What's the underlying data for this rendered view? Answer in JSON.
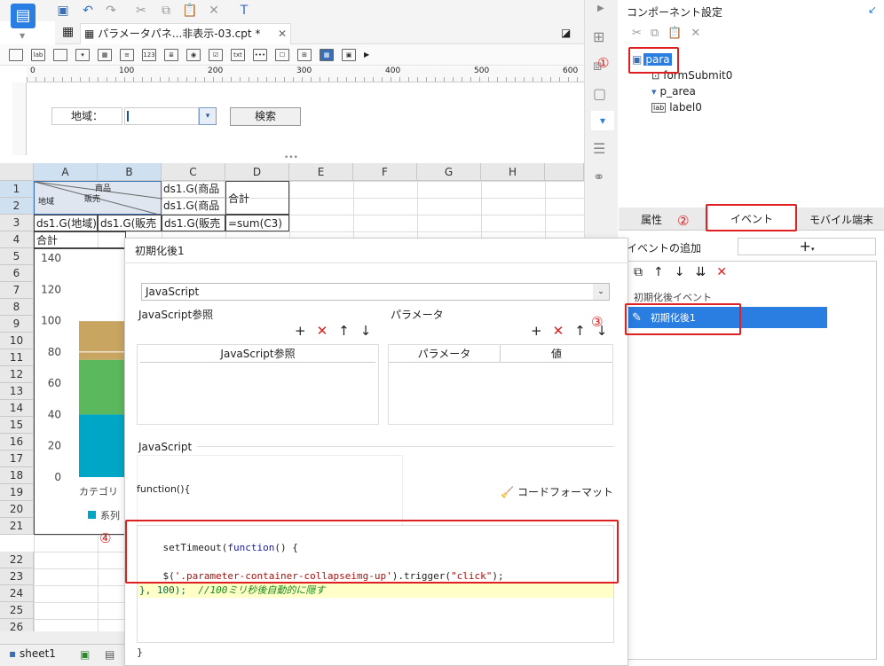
{
  "tab": {
    "title": "パラメータパネ...非表示-03.cpt *"
  },
  "param_panel": {
    "area_label": "地域：",
    "search_label": "検索"
  },
  "ruler": {
    "ticks": [
      "0",
      "100",
      "200",
      "300",
      "400",
      "500",
      "600"
    ]
  },
  "sheet": {
    "columns": [
      "A",
      "B",
      "C",
      "D",
      "E",
      "F",
      "G",
      "H"
    ],
    "rows": [
      "1",
      "2",
      "3",
      "4",
      "5",
      "6",
      "7",
      "8",
      "9",
      "10",
      "11",
      "12",
      "13",
      "14",
      "15",
      "16",
      "17",
      "18",
      "19",
      "20",
      "21",
      "22",
      "23",
      "24",
      "25",
      "26"
    ],
    "cells": {
      "a1_top": "商品",
      "a1_mid": "販売",
      "a1_left": "地域",
      "c1": "ds1.G(商品",
      "c2": "ds1.G(商品",
      "d1": "合計",
      "a3": "ds1.G(地域)",
      "b3": "ds1.G(販売",
      "c3": "ds1.G(販売",
      "d3": "=sum(C3)",
      "a4": "合計"
    },
    "tab_label": "sheet1"
  },
  "chart_data": {
    "type": "bar",
    "ylim": [
      0,
      140
    ],
    "yticks": [
      "140",
      "120",
      "100",
      "80",
      "60",
      "40",
      "20",
      "0"
    ],
    "categories": [
      "カテゴリ"
    ],
    "series_label": "系列",
    "segments": [
      {
        "color": "#00a6c6",
        "from": 0,
        "to": 40
      },
      {
        "color": "#5cb85c",
        "from": 40,
        "to": 75
      },
      {
        "color": "#c8a560",
        "from": 75,
        "to": 100
      }
    ]
  },
  "dialog": {
    "title": "初期化後1",
    "language": "JavaScript",
    "js_ref_title": "JavaScript参照",
    "js_ref_col": "JavaScript参照",
    "param_title": "パラメータ",
    "param_col1": "パラメータ",
    "param_col2": "値",
    "js_title": "JavaScript",
    "func_open": "function(){",
    "code_format": "コードフォーマット",
    "code_line1_a": "setTimeout(",
    "code_line1_b": "function",
    "code_line1_c": "() {",
    "code_line2_a": "    $(",
    "code_line2_b": "'.parameter-container-collapseimg-up'",
    "code_line2_c": ").trigger(",
    "code_line2_d": "\"click\"",
    "code_line2_e": ");",
    "code_line3_a": "}, 100);",
    "code_line3_b": "  //100ミリ秒後自動的に隠す",
    "func_close": "}"
  },
  "right_panel": {
    "title": "コンポーネント設定",
    "tree": {
      "root": "para",
      "items": [
        "formSubmit0",
        "p_area",
        "label0"
      ]
    },
    "tabs": [
      "属性",
      "イベント",
      "モバイル端末"
    ],
    "add_event_label": "イベントの追加",
    "event_group": "初期化後イベント",
    "event_item": "初期化後1"
  },
  "annotations": [
    "①",
    "②",
    "③",
    "④"
  ]
}
